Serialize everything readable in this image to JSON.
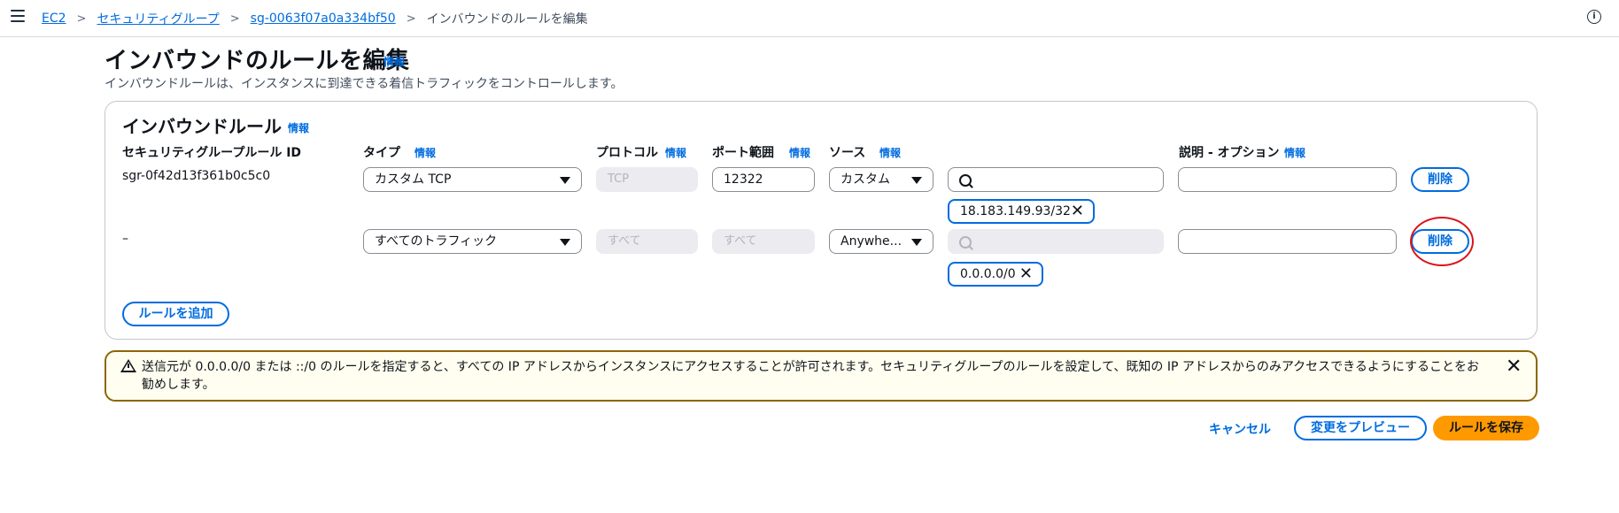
{
  "breadcrumb": {
    "items": [
      "EC2",
      "セキュリティグループ",
      "sg-0063f07a0a334bf50"
    ],
    "current": "インバウンドのルールを編集"
  },
  "header": {
    "title": "インバウンドのルールを編集",
    "info": "情報",
    "description": "インバウンドルールは、インスタンスに到達できる着信トラフィックをコントロールします。"
  },
  "panel": {
    "title": "インバウンドルール",
    "info": "情報",
    "columns": {
      "rule_id": "セキュリティグループルール ID",
      "type": "タイプ",
      "protocol": "プロトコル",
      "port": "ポート範囲",
      "source": "ソース",
      "description": "説明 - オプション",
      "info": "情報"
    },
    "rows": [
      {
        "rule_id": "sgr-0f42d13f361b0c5c0",
        "type": "カスタム TCP",
        "protocol": "TCP",
        "port": "12322",
        "source": "カスタム",
        "search": "",
        "token": "18.183.149.93/32",
        "description": "",
        "delete": "削除"
      },
      {
        "rule_id": "–",
        "type": "すべてのトラフィック",
        "protocol": "すべて",
        "port": "すべて",
        "source": "Anywhe...",
        "search": "",
        "token": "0.0.0.0/0",
        "description": "",
        "delete": "削除"
      }
    ],
    "add_rule": "ルールを追加"
  },
  "alert": {
    "text": "送信元が 0.0.0.0/0 または ::/0 のルールを指定すると、すべての IP アドレスからインスタンスにアクセスすることが許可されます。セキュリティグループのルールを設定して、既知の IP アドレスからのみアクセスできるようにすることをお勧めします。",
    "close": "✕"
  },
  "footer": {
    "cancel": "キャンセル",
    "preview": "変更をプレビュー",
    "save": "ルールを保存"
  },
  "colors": {
    "accent": "#006ce0",
    "primary": "#ff9900",
    "warning_border": "#8d6605",
    "highlight": "#d9141a"
  }
}
